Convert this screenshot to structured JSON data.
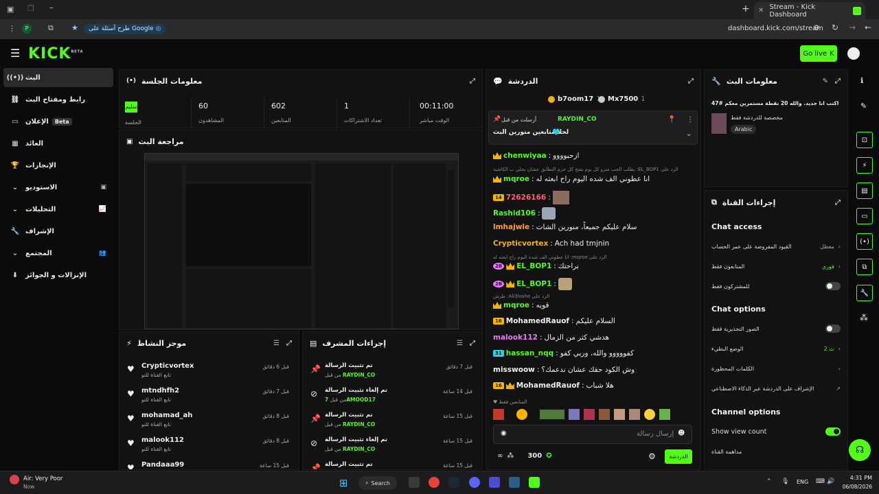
{
  "browser": {
    "tab_title": "Stream - Kick Dashboard",
    "url": "dashboard.kick.com/stream",
    "search_pill": "طرح أسئلة على Google"
  },
  "header": {
    "logo": "KICK",
    "logo_sup": "BETA",
    "go_live": "Go live"
  },
  "sidebar": {
    "items": [
      {
        "label": "البث",
        "icon": "broadcast-icon"
      },
      {
        "label": "رابط ومفتاح البث",
        "icon": "link-icon"
      },
      {
        "label": "الإعلان",
        "badge": "Beta",
        "icon": "ad-icon"
      },
      {
        "label": "العائد",
        "icon": "revenue-icon"
      },
      {
        "label": "الإنجازات",
        "icon": "trophy-icon"
      },
      {
        "label": "الاستوديو",
        "icon": "studio-icon"
      },
      {
        "label": "التحليلات",
        "icon": "analytics-icon"
      },
      {
        "label": "الإشراف",
        "icon": "moderation-icon"
      },
      {
        "label": "المجتمع",
        "icon": "community-icon"
      },
      {
        "label": "الإنزالات و الجوائز",
        "icon": "drops-icon"
      }
    ]
  },
  "session": {
    "title": "معلومات الجلسة",
    "status": "سليم",
    "status_label": "الجلسة",
    "stats": [
      {
        "value": "60",
        "label": "المشاهدون"
      },
      {
        "value": "602",
        "label": "المتابعين"
      },
      {
        "value": "1",
        "label": "تعداد الاشتراكات"
      },
      {
        "value": "00:11:00",
        "label": "الوقت مباشر"
      }
    ]
  },
  "preview": {
    "title": "مراجعة البث"
  },
  "activity": {
    "title": "موجز النشاط",
    "rows": [
      {
        "name": "Crypticvortex",
        "sub": "تابع القناة للتو",
        "time": "قبل 6 دقائق"
      },
      {
        "name": "mtndhfh2",
        "sub": "تابع القناة للتو",
        "time": "قبل 7 دقائق"
      },
      {
        "name": "mohamad_ah",
        "sub": "تابع القناة للتو",
        "time": "قبل 8 دقائق"
      },
      {
        "name": "malook112",
        "sub": "تابع القناة للتو",
        "time": "قبل 8 دقائق"
      },
      {
        "name": "Pandaaa99",
        "sub": "",
        "time": "قبل 15 ساعة"
      }
    ]
  },
  "modactions": {
    "title": "إجراءات المشرف",
    "rows": [
      {
        "action": "تم تثبيت الرسالة",
        "by": "RAYDIN_CO",
        "by_prefix": "من قبل",
        "time": "قبل 7 دقائق"
      },
      {
        "action": "تم إلغاء تثبيت الرسالة",
        "by": "7AMOOD17",
        "by_prefix": "من قبل",
        "time": "قبل 14 ساعة"
      },
      {
        "action": "تم تثبيت الرسالة",
        "by": "RAYDIN_CO",
        "by_prefix": "من قبل",
        "time": "قبل 15 ساعة"
      },
      {
        "action": "تم إلغاء تثبيت الرسالة",
        "by": "RAYDIN_CO",
        "by_prefix": "من قبل",
        "time": "قبل 15 ساعة"
      },
      {
        "action": "تم تثبيت الرسالة",
        "by": "",
        "by_prefix": "",
        "time": "قبل 15 ساعة"
      }
    ]
  },
  "chat": {
    "title": "الدردشة",
    "top_gifters": [
      {
        "name": "b7oom17",
        "count": "1"
      },
      {
        "name": "Mx7500",
        "count": "1"
      }
    ],
    "pinned": {
      "by_label": "أرسلت من قبل",
      "by": "RAYDIN_CO",
      "text": "لحلا متابعين متورين البث"
    },
    "messages": [
      {
        "user": "chenwiyaa",
        "color": "#53fc18",
        "text": "ازحبوووو",
        "badges": [
          "crown"
        ]
      },
      {
        "reply": "يطلب الحب مترو كل يوم يفتح كل حزم التطابق عشان بحلي ب الكاشية :EL_BOP1 الرد على"
      },
      {
        "user": "mqroe",
        "color": "#53fc18",
        "text": "انا عطوني الف شده اليوم راح ابعثه له",
        "badges": [
          "crown"
        ]
      },
      {
        "user": "72626166",
        "color": "#ff5c7a",
        "text": "",
        "badges": [
          "14"
        ]
      },
      {
        "user": "Rashid106",
        "color": "#53fc18",
        "text": "",
        "badges": []
      },
      {
        "user": "lmhajwle",
        "color": "#ff9e3d",
        "text": "سلام عليكم جميعاً، منورين الشات",
        "badges": []
      },
      {
        "user": "Crypticvortex",
        "color": "#f4b400",
        "text": "Ach had tmjnin",
        "badges": []
      },
      {
        "reply": "انا عطوني الف شده اليوم راح ابعثه له :mqroe الرد على"
      },
      {
        "user": "EL_BOP1",
        "color": "#53fc18",
        "text": "براحتك",
        "badges": [
          "2B",
          "crown"
        ]
      },
      {
        "user": "EL_BOP1",
        "color": "#53fc18",
        "text": "",
        "badges": [
          "2B",
          "crown"
        ]
      },
      {
        "reply": "طرش :Ali3loshe الرد على"
      },
      {
        "user": "mqroe",
        "color": "#53fc18",
        "text": "قويه",
        "badges": [
          "crown"
        ]
      },
      {
        "user": "MohamedRauof",
        "color": "#eeeeee",
        "text": "السلام عليكم",
        "badges": [
          "16"
        ]
      },
      {
        "user": "malook112",
        "color": "#e879f9",
        "text": "هدشي كثر من الزمال",
        "badges": []
      },
      {
        "user": "hassan_nqq",
        "color": "#53fc18",
        "text": "كفووووو والله، وربي كفو",
        "badges": [
          "31"
        ]
      },
      {
        "user": "misswoow",
        "color": "#eeeeee",
        "text": "وش الكود حقك عشان ندعمك؟",
        "badges": []
      },
      {
        "user": "MohamedRauof",
        "color": "#eeeeee",
        "text": "هلا شباب",
        "badges": [
          "16",
          "crown"
        ]
      }
    ],
    "followers_only": "المتابعين فقط",
    "input_placeholder": "إرسال رسالة",
    "points": "300",
    "send_label": "الدردشة"
  },
  "stream_info": {
    "title": "معلومات البث",
    "stream_title": "اكتب انا جديد. والله 20 نقطة مستمرين معكم #47",
    "category": "مخصصة للدردشة فقط",
    "tag": "Arabic"
  },
  "channel_actions": {
    "title": "إجراءات القناة",
    "chat_access": {
      "heading": "Chat access",
      "rows": [
        {
          "label": "القيود المفروضة على عمر الحساب",
          "value": "معطل"
        },
        {
          "label": "المتابعون فقط",
          "value": "فوري"
        },
        {
          "label": "للمشتركون فقط",
          "value": ""
        }
      ]
    },
    "chat_options": {
      "heading": "Chat options",
      "rows": [
        {
          "label": "الصور التحذيرية فقط",
          "value": ""
        },
        {
          "label": "الوضع البطيء",
          "value": "2 ث"
        },
        {
          "label": "الكلمات المحظورة",
          "value": ""
        },
        {
          "label": "الإشراف على الدردشة عبر الذكاء الاصطناعي",
          "value": ""
        }
      ]
    },
    "channel_options": {
      "heading": "Channel options",
      "show_view_count": "Show view count",
      "raid": "مداهمة القناة"
    }
  },
  "taskbar": {
    "weather_title": "Air: Very Poor",
    "weather_sub": "Now",
    "search": "Search",
    "lang": "ENG",
    "time": "4:31 PM",
    "date": "06/08/2026"
  }
}
